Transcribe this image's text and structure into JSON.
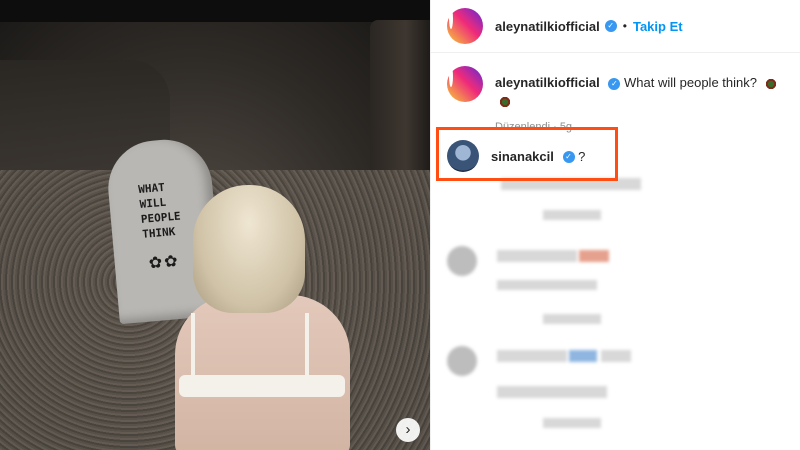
{
  "post": {
    "image": {
      "tombstone_text": "WHAT\nWILL\nPEOPLE\nTHINK"
    },
    "next_icon": "chevron-right-icon"
  },
  "header": {
    "username": "aleynatilkiofficial",
    "separator": "•",
    "follow_label": "Takip Et"
  },
  "caption": {
    "username": "aleynatilkiofficial",
    "text": "What will people think?",
    "meta": "Düzenlendi · 5g"
  },
  "highlighted_comment": {
    "username": "sinanakcil",
    "text": "?"
  },
  "colors": {
    "accent": "#0095f6",
    "highlight_border": "#ff4d14",
    "verified": "#3897f0"
  }
}
